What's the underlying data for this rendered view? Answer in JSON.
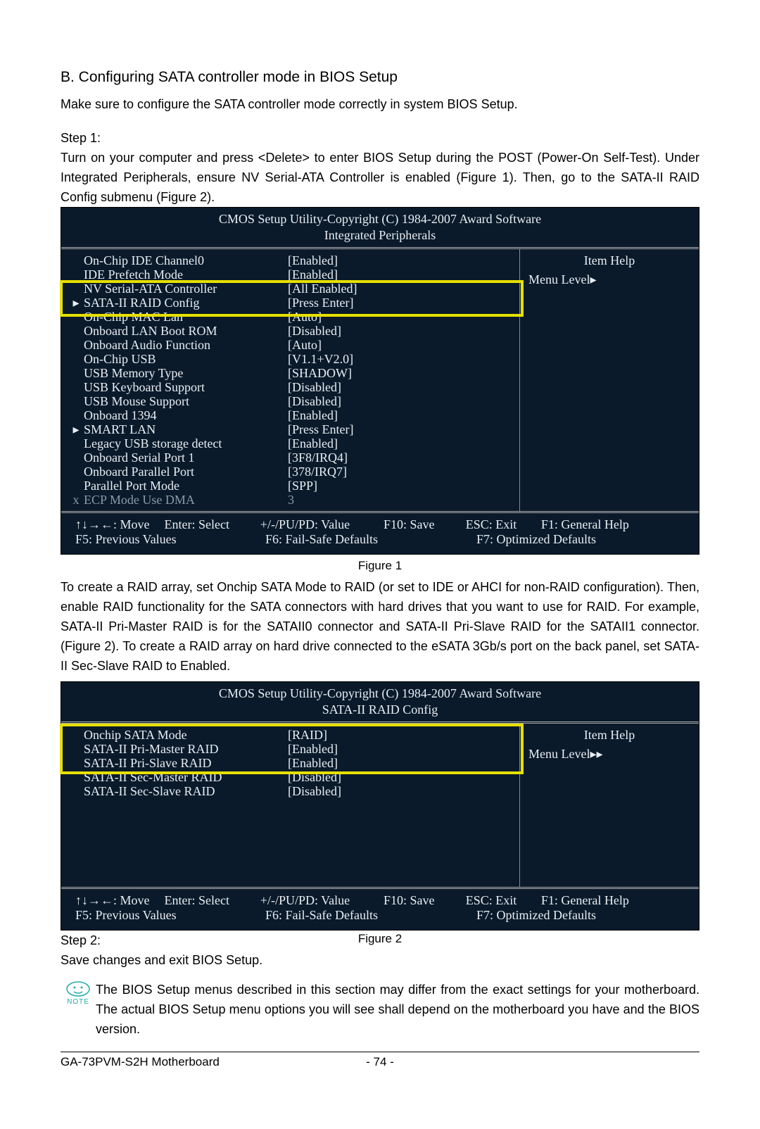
{
  "heading": "B. Configuring SATA controller mode in BIOS Setup",
  "intro": "Make sure to configure the SATA controller mode correctly in system BIOS Setup.",
  "step1_label": "Step 1:",
  "step1_para": "Turn on your computer and press <Delete> to enter BIOS Setup during the POST (Power-On Self-Test). Under Integrated Peripherals, ensure NV Serial-ATA Controller is enabled (Figure 1). Then, go to the SATA-II RAID Config submenu (Figure 2).",
  "bios_header": "CMOS Setup Utility-Copyright (C) 1984-2007 Award Software",
  "fig1": {
    "subtitle": "Integrated Peripherals",
    "rows": [
      {
        "mk": "",
        "label": "On-Chip IDE Channel0",
        "value": "[Enabled]"
      },
      {
        "mk": "",
        "label": "IDE Prefetch Mode",
        "value": "[Enabled]"
      },
      {
        "mk": "",
        "label": "NV Serial-ATA Controller",
        "value": "[All Enabled]"
      },
      {
        "mk": "▸",
        "label": "SATA-II RAID Config",
        "value": "[Press Enter]"
      },
      {
        "mk": "",
        "label": "On-Chip MAC Lan",
        "value": "[Auto]"
      },
      {
        "mk": "",
        "label": "Onboard LAN Boot ROM",
        "value": "[Disabled]"
      },
      {
        "mk": "",
        "label": "Onboard Audio Function",
        "value": "[Auto]"
      },
      {
        "mk": "",
        "label": "On-Chip USB",
        "value": "[V1.1+V2.0]"
      },
      {
        "mk": "",
        "label": "USB Memory Type",
        "value": "[SHADOW]"
      },
      {
        "mk": "",
        "label": "USB Keyboard Support",
        "value": "[Disabled]"
      },
      {
        "mk": "",
        "label": "USB Mouse Support",
        "value": "[Disabled]"
      },
      {
        "mk": "",
        "label": "Onboard 1394",
        "value": "[Enabled]"
      },
      {
        "mk": "▸",
        "label": "SMART LAN",
        "value": "[Press Enter]"
      },
      {
        "mk": "",
        "label": "Legacy USB storage detect",
        "value": "[Enabled]"
      },
      {
        "mk": "",
        "label": "Onboard Serial Port 1",
        "value": "[3F8/IRQ4]"
      },
      {
        "mk": "",
        "label": "Onboard Parallel Port",
        "value": "[378/IRQ7]"
      },
      {
        "mk": "",
        "label": "Parallel Port Mode",
        "value": "[SPP]"
      },
      {
        "mk": "x",
        "label": "ECP Mode Use DMA",
        "value": "3",
        "dim": true
      }
    ],
    "item_help": "Item Help",
    "menu_level": "Menu Level▸",
    "caption": "Figure 1"
  },
  "mid_para": "To create a RAID array, set Onchip SATA Mode to RAID (or set to IDE or AHCI for non-RAID configuration). Then, enable RAID functionality for the SATA connectors with hard drives that you want to use for RAID. For example, SATA-II Pri-Master RAID is for the SATAII0 connector and SATA-II Pri-Slave RAID for the SATAII1 connector. (Figure 2). To create a RAID array on hard drive connected to the eSATA 3Gb/s port on the back panel, set SATA-II Sec-Slave RAID to Enabled.",
  "fig2": {
    "subtitle": "SATA-II RAID Config",
    "rows": [
      {
        "mk": "",
        "label": "Onchip SATA Mode",
        "value": "[RAID]"
      },
      {
        "mk": "",
        "label": "SATA-II Pri-Master RAID",
        "value": "[Enabled]"
      },
      {
        "mk": "",
        "label": "SATA-II Pri-Slave RAID",
        "value": "[Enabled]"
      },
      {
        "mk": "",
        "label": "SATA-II Sec-Master RAID",
        "value": "[Disabled]"
      },
      {
        "mk": "",
        "label": "SATA-II Sec-Slave RAID",
        "value": "[Disabled]"
      }
    ],
    "item_help": "Item Help",
    "menu_level": "Menu Level▸▸",
    "caption": "Figure 2"
  },
  "footer_keys": {
    "r1c1": "↑↓→←: Move",
    "r1c2": "Enter: Select",
    "r1c3": "+/-/PU/PD: Value",
    "r1c4": "F10: Save",
    "r1c5": "ESC: Exit",
    "r1c6": "F1: General Help",
    "r2c1": "F5: Previous Values",
    "r2c3": "F6: Fail-Safe Defaults",
    "r2c5": "F7: Optimized Defaults"
  },
  "step2_label": "Step 2:",
  "step2_text": "Save changes and exit BIOS Setup.",
  "note_label": "NOTE",
  "note_text": "The BIOS Setup menus described in this section may differ from the exact settings for your motherboard. The actual BIOS Setup menu options you will see shall depend on the motherboard you have and the BIOS version.",
  "page_footer_left": "GA-73PVM-S2H Motherboard",
  "page_footer_center": "- 74 -"
}
